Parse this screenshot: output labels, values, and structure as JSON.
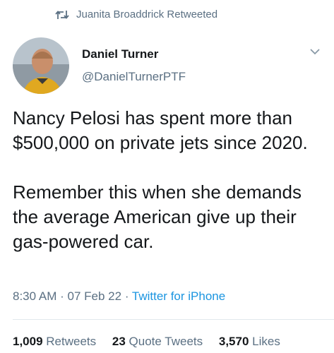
{
  "retweeted_by": "Juanita Broaddrick Retweeted",
  "author": {
    "display_name": "Daniel Turner",
    "handle": "@DanielTurnerPTF"
  },
  "tweet": {
    "paragraphs": [
      "Nancy Pelosi has spent more than $500,000 on private jets since 2020.",
      "Remember this when she demands the average American give up their gas-powered car."
    ]
  },
  "meta": {
    "time": "8:30 AM",
    "separator": "·",
    "date": "07 Feb 22",
    "source": "Twitter for iPhone"
  },
  "stats": {
    "retweets_count": "1,009",
    "retweets_label": "Retweets",
    "quote_count": "23",
    "quote_label": "Quote Tweets",
    "likes_count": "3,570",
    "likes_label": "Likes"
  },
  "colors": {
    "text": "#14171a",
    "secondary": "#5b7083",
    "link": "#1b95e0",
    "divider": "#e1e8ed"
  },
  "icons": {
    "retweet": "retweet-icon",
    "menu": "chevron-down-icon"
  }
}
